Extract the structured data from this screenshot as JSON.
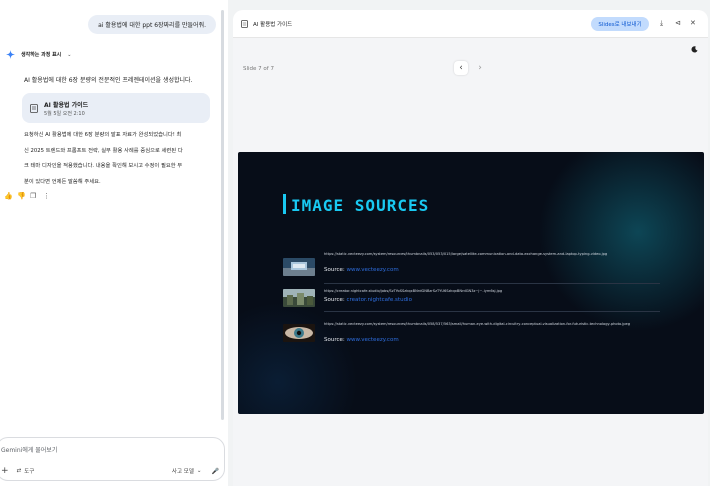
{
  "chat": {
    "user_message": "ai 활용법에 대한 ppt 6장짜리를 만들어줘.",
    "thinking_label": "생각하는 과정 표시",
    "intro_text": "AI 활용법에 대한 6장 분량의 전문적인 프레젠테이션을 생성합니다.",
    "doc_card": {
      "title": "AI 활용법 가이드",
      "time": "5월 5일 오전 2:10"
    },
    "response_lines": [
      "요청하신 AI 활용법에 대한 6장 분량의 발표 자료가 완성되었습니다! 최",
      "신 2025 트렌드와 프롬프트 전략, 실무 활용 사례를 중심으로 세련된 다",
      "크 테마 디자인을 적용했습니다. 내용을 확인해 보시고 수정이 필요한 부",
      "분이 있다면 언제든 말씀해 주세요."
    ],
    "input_placeholder": "Gemini에게 물어보기",
    "tools_label": "도구",
    "model_label": "사고 모델"
  },
  "canvas": {
    "title": "AI 활용법 가이드",
    "export_label": "Slides로 내보내기",
    "slide_counter": "Slide 7 of 7",
    "slide": {
      "title": "IMAGE SOURCES",
      "sources": [
        {
          "url": "https://static.vecteezy.com/system/resources/thumbnails/053/053/015/large/satellite-communication-and-data-exchange-system-and-laptop-typing-video.jpg",
          "source_label": "Source:",
          "source_name": "www.vecteezy.com"
        },
        {
          "url": "https://creator.nightcafe.studio/jobs/SzTYoSSzkqxBNrdGNBzrSzTYU6SzkqxBNrdGN3z~j~-iym6sj.jpg",
          "source_label": "Source:",
          "source_name": "creator.nightcafe.studio"
        },
        {
          "url": "https://static.vecteezy.com/system/resources/thumbnails/058/537/563/small/human-eye-with-digital-circuitry-conceptual-visualization-for-futuristic-technology-photo.jpeg",
          "source_label": "Source:",
          "source_name": "www.vecteezy.com"
        }
      ]
    }
  },
  "colors": {
    "accent": "#19c9f2",
    "link": "#2f6fe0",
    "export_bg": "#c2dbfd",
    "slide_bg": "#070d18"
  }
}
